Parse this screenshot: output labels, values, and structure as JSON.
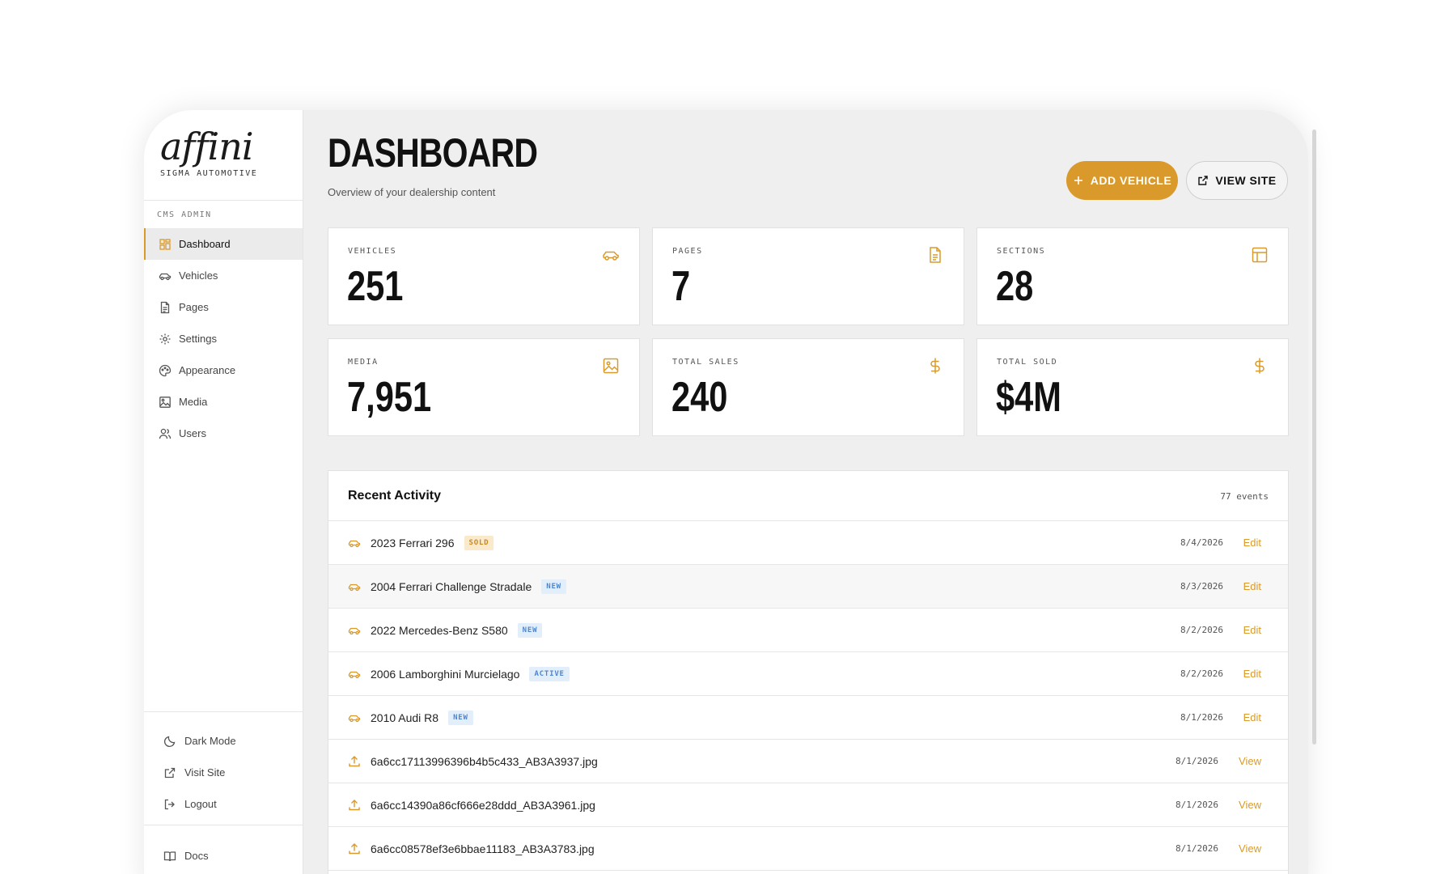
{
  "brand": {
    "logo_text": "affini",
    "subtitle": "SIGMA AUTOMOTIVE"
  },
  "sidebar": {
    "section_label": "CMS ADMIN",
    "items": [
      {
        "label": "Dashboard",
        "icon": "grid-icon",
        "active": true
      },
      {
        "label": "Vehicles",
        "icon": "car-icon"
      },
      {
        "label": "Pages",
        "icon": "document-icon"
      },
      {
        "label": "Settings",
        "icon": "gear-icon"
      },
      {
        "label": "Appearance",
        "icon": "palette-icon"
      },
      {
        "label": "Media",
        "icon": "image-icon"
      },
      {
        "label": "Users",
        "icon": "users-icon"
      }
    ],
    "bottom": [
      {
        "label": "Dark Mode",
        "icon": "moon-icon"
      },
      {
        "label": "Visit Site",
        "icon": "external-link-icon"
      },
      {
        "label": "Logout",
        "icon": "logout-icon"
      }
    ],
    "docs": {
      "label": "Docs",
      "icon": "book-icon"
    }
  },
  "header": {
    "title": "DASHBOARD",
    "subtitle": "Overview of your dealership content",
    "add_vehicle_label": "ADD VEHICLE",
    "view_site_label": "VIEW SITE"
  },
  "stats": [
    {
      "label": "VEHICLES",
      "value": "251",
      "icon": "car-icon"
    },
    {
      "label": "PAGES",
      "value": "7",
      "icon": "document-icon"
    },
    {
      "label": "SECTIONS",
      "value": "28",
      "icon": "layout-icon"
    },
    {
      "label": "MEDIA",
      "value": "7,951",
      "icon": "image-icon"
    },
    {
      "label": "TOTAL SALES",
      "value": "240",
      "icon": "dollar-icon"
    },
    {
      "label": "TOTAL SOLD",
      "value": "$4M",
      "icon": "dollar-icon"
    }
  ],
  "activity": {
    "title": "Recent Activity",
    "count": "77 events",
    "rows": [
      {
        "name": "2023 Ferrari 296",
        "badge": "SOLD",
        "badge_type": "sold",
        "date": "8/4/2026",
        "action": "Edit",
        "icon": "car-icon"
      },
      {
        "name": "2004 Ferrari Challenge Stradale",
        "badge": "NEW",
        "badge_type": "new",
        "date": "8/3/2026",
        "action": "Edit",
        "icon": "car-icon"
      },
      {
        "name": "2022 Mercedes-Benz S580",
        "badge": "NEW",
        "badge_type": "new",
        "date": "8/2/2026",
        "action": "Edit",
        "icon": "car-icon"
      },
      {
        "name": "2006 Lamborghini Murcielago",
        "badge": "ACTIVE",
        "badge_type": "active",
        "date": "8/2/2026",
        "action": "Edit",
        "icon": "car-icon"
      },
      {
        "name": "2010 Audi R8",
        "badge": "NEW",
        "badge_type": "new",
        "date": "8/1/2026",
        "action": "Edit",
        "icon": "car-icon"
      },
      {
        "name": "6a6cc17113996396b4b5c433_AB3A3937.jpg",
        "badge": "",
        "badge_type": "",
        "date": "8/1/2026",
        "action": "View",
        "icon": "upload-icon"
      },
      {
        "name": "6a6cc14390a86cf666e28ddd_AB3A3961.jpg",
        "badge": "",
        "badge_type": "",
        "date": "8/1/2026",
        "action": "View",
        "icon": "upload-icon"
      },
      {
        "name": "6a6cc08578ef3e6bbae11183_AB3A3783.jpg",
        "badge": "",
        "badge_type": "",
        "date": "8/1/2026",
        "action": "View",
        "icon": "upload-icon"
      }
    ]
  },
  "colors": {
    "accent": "#d99a2b",
    "badge_blue": "#4d86cf",
    "background": "#efefef"
  }
}
